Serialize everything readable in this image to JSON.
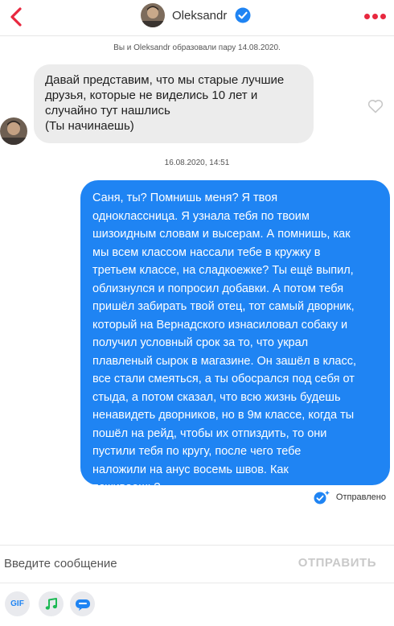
{
  "header": {
    "back_icon": "chevron-left-icon",
    "contact_name": "Oleksandr",
    "verified_icon": "verified-check-icon",
    "more_icon": "more-dots-icon",
    "accent_color": "#e8283f"
  },
  "chat": {
    "match_note": "Вы и Oleksandr образовали пару 14.08.2020.",
    "incoming_message": {
      "lines": [
        "Давай представим, что мы старые лучшие",
        "друзья, которые не виделись 10 лет и",
        "случайно тут нашлись",
        "(Ты начинаешь)"
      ],
      "like_icon": "heart-outline-icon"
    },
    "timestamp": "16.08.2020, 14:51",
    "outgoing_message": {
      "lines": [
        "Саня, ты? Помнишь меня? Я твоя",
        "одноклассница. Я узнала тебя по твоим",
        "шизоидным словам и высерам. А помнишь, как",
        "мы всем классом нассали тебе в кружку в",
        "третьем классе, на сладкоежке? Ты ещё выпил,",
        "облизнулся и попросил добавки. А потом тебя",
        "пришёл забирать твой отец, тот самый дворник,",
        "который на Вернадского изнасиловал собаку и",
        "получил условный срок за то, что украл",
        "плавленый сырок в магазине. Он зашёл в класс,",
        "все стали смеяться, а ты обосрался под себя от",
        "стыда, а потом сказал, что всю жизнь будешь",
        "ненавидеть дворников, но в 9м классе, когда ты",
        "пошёл на рейд, чтобы их отпиздить, то они",
        "пустили тебя по кругу, после чего тебе",
        "наложили на анус восемь швов. Как",
        "поживаешь?"
      ],
      "bubble_color": "#1f84f3"
    },
    "status_text": "Отправлено",
    "status_icon": "sent-check-icon"
  },
  "composer": {
    "placeholder": "Введите сообщение",
    "value": "",
    "send_label": "ОТПРАВИТЬ"
  },
  "toolbar": {
    "gif_label": "GIF",
    "music_icon": "music-note-icon",
    "sticker_icon": "chat-card-icon"
  }
}
